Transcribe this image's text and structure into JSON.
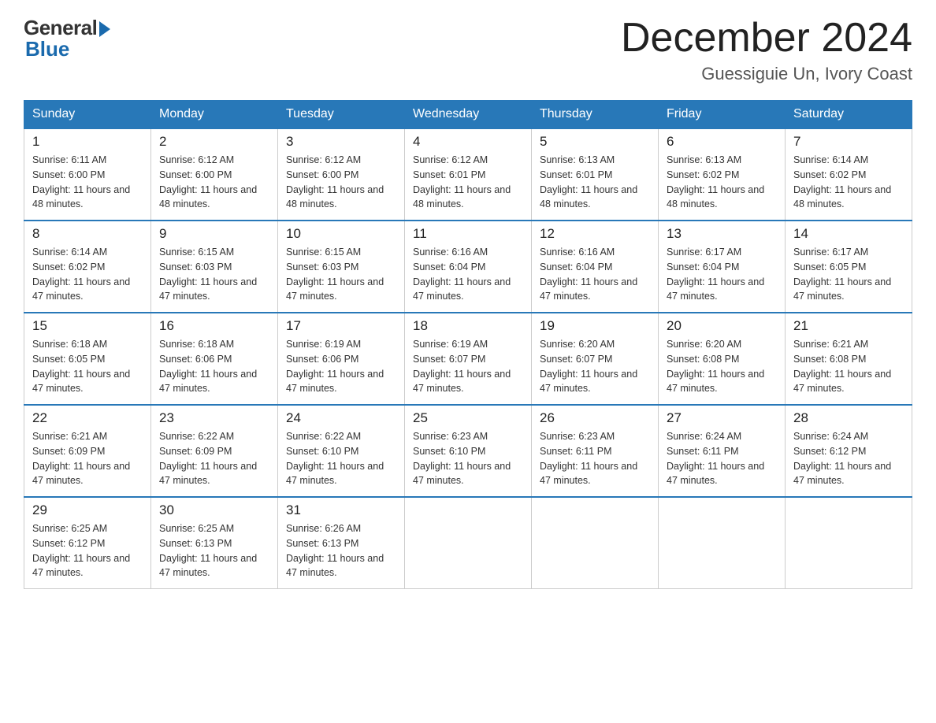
{
  "header": {
    "logo": {
      "general": "General",
      "blue": "Blue"
    },
    "title": "December 2024",
    "location": "Guessiguie Un, Ivory Coast"
  },
  "weekdays": [
    "Sunday",
    "Monday",
    "Tuesday",
    "Wednesday",
    "Thursday",
    "Friday",
    "Saturday"
  ],
  "weeks": [
    [
      {
        "day": "1",
        "sunrise": "6:11 AM",
        "sunset": "6:00 PM",
        "daylight": "11 hours and 48 minutes."
      },
      {
        "day": "2",
        "sunrise": "6:12 AM",
        "sunset": "6:00 PM",
        "daylight": "11 hours and 48 minutes."
      },
      {
        "day": "3",
        "sunrise": "6:12 AM",
        "sunset": "6:00 PM",
        "daylight": "11 hours and 48 minutes."
      },
      {
        "day": "4",
        "sunrise": "6:12 AM",
        "sunset": "6:01 PM",
        "daylight": "11 hours and 48 minutes."
      },
      {
        "day": "5",
        "sunrise": "6:13 AM",
        "sunset": "6:01 PM",
        "daylight": "11 hours and 48 minutes."
      },
      {
        "day": "6",
        "sunrise": "6:13 AM",
        "sunset": "6:02 PM",
        "daylight": "11 hours and 48 minutes."
      },
      {
        "day": "7",
        "sunrise": "6:14 AM",
        "sunset": "6:02 PM",
        "daylight": "11 hours and 48 minutes."
      }
    ],
    [
      {
        "day": "8",
        "sunrise": "6:14 AM",
        "sunset": "6:02 PM",
        "daylight": "11 hours and 47 minutes."
      },
      {
        "day": "9",
        "sunrise": "6:15 AM",
        "sunset": "6:03 PM",
        "daylight": "11 hours and 47 minutes."
      },
      {
        "day": "10",
        "sunrise": "6:15 AM",
        "sunset": "6:03 PM",
        "daylight": "11 hours and 47 minutes."
      },
      {
        "day": "11",
        "sunrise": "6:16 AM",
        "sunset": "6:04 PM",
        "daylight": "11 hours and 47 minutes."
      },
      {
        "day": "12",
        "sunrise": "6:16 AM",
        "sunset": "6:04 PM",
        "daylight": "11 hours and 47 minutes."
      },
      {
        "day": "13",
        "sunrise": "6:17 AM",
        "sunset": "6:04 PM",
        "daylight": "11 hours and 47 minutes."
      },
      {
        "day": "14",
        "sunrise": "6:17 AM",
        "sunset": "6:05 PM",
        "daylight": "11 hours and 47 minutes."
      }
    ],
    [
      {
        "day": "15",
        "sunrise": "6:18 AM",
        "sunset": "6:05 PM",
        "daylight": "11 hours and 47 minutes."
      },
      {
        "day": "16",
        "sunrise": "6:18 AM",
        "sunset": "6:06 PM",
        "daylight": "11 hours and 47 minutes."
      },
      {
        "day": "17",
        "sunrise": "6:19 AM",
        "sunset": "6:06 PM",
        "daylight": "11 hours and 47 minutes."
      },
      {
        "day": "18",
        "sunrise": "6:19 AM",
        "sunset": "6:07 PM",
        "daylight": "11 hours and 47 minutes."
      },
      {
        "day": "19",
        "sunrise": "6:20 AM",
        "sunset": "6:07 PM",
        "daylight": "11 hours and 47 minutes."
      },
      {
        "day": "20",
        "sunrise": "6:20 AM",
        "sunset": "6:08 PM",
        "daylight": "11 hours and 47 minutes."
      },
      {
        "day": "21",
        "sunrise": "6:21 AM",
        "sunset": "6:08 PM",
        "daylight": "11 hours and 47 minutes."
      }
    ],
    [
      {
        "day": "22",
        "sunrise": "6:21 AM",
        "sunset": "6:09 PM",
        "daylight": "11 hours and 47 minutes."
      },
      {
        "day": "23",
        "sunrise": "6:22 AM",
        "sunset": "6:09 PM",
        "daylight": "11 hours and 47 minutes."
      },
      {
        "day": "24",
        "sunrise": "6:22 AM",
        "sunset": "6:10 PM",
        "daylight": "11 hours and 47 minutes."
      },
      {
        "day": "25",
        "sunrise": "6:23 AM",
        "sunset": "6:10 PM",
        "daylight": "11 hours and 47 minutes."
      },
      {
        "day": "26",
        "sunrise": "6:23 AM",
        "sunset": "6:11 PM",
        "daylight": "11 hours and 47 minutes."
      },
      {
        "day": "27",
        "sunrise": "6:24 AM",
        "sunset": "6:11 PM",
        "daylight": "11 hours and 47 minutes."
      },
      {
        "day": "28",
        "sunrise": "6:24 AM",
        "sunset": "6:12 PM",
        "daylight": "11 hours and 47 minutes."
      }
    ],
    [
      {
        "day": "29",
        "sunrise": "6:25 AM",
        "sunset": "6:12 PM",
        "daylight": "11 hours and 47 minutes."
      },
      {
        "day": "30",
        "sunrise": "6:25 AM",
        "sunset": "6:13 PM",
        "daylight": "11 hours and 47 minutes."
      },
      {
        "day": "31",
        "sunrise": "6:26 AM",
        "sunset": "6:13 PM",
        "daylight": "11 hours and 47 minutes."
      },
      null,
      null,
      null,
      null
    ]
  ]
}
